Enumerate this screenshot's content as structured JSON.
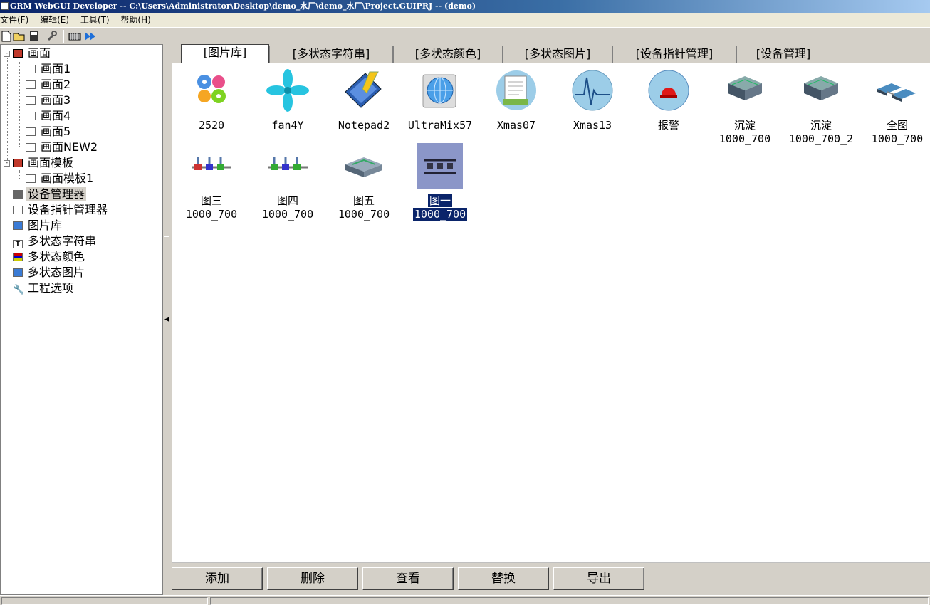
{
  "window": {
    "title": "GRM WebGUI Developer -- C:\\Users\\Administrator\\Desktop\\demo_水厂\\demo_水厂\\Project.GUIPRJ -- (demo)"
  },
  "menu": [
    {
      "label": "文件(F)"
    },
    {
      "label": "编辑(E)"
    },
    {
      "label": "工具(T)"
    },
    {
      "label": "帮助(H)"
    }
  ],
  "toolbar_icons": [
    "new-icon",
    "open-icon",
    "save-icon",
    "wrench-icon",
    "device-icon",
    "run-icon"
  ],
  "tree": {
    "pages_label": "画面",
    "pages": [
      "画面1",
      "画面2",
      "画面3",
      "画面4",
      "画面5",
      "画面NEW2"
    ],
    "templates_label": "画面模板",
    "templates": [
      "画面模板1"
    ],
    "others": [
      "设备管理器",
      "设备指针管理器",
      "图片库",
      "多状态字符串",
      "多状态颜色",
      "多状态图片",
      "工程选项"
    ]
  },
  "tabs": [
    "[图片库]",
    "[多状态字符串]",
    "[多状态颜色]",
    "[多状态图片]",
    "[设备指针管理]",
    "[设备管理]"
  ],
  "gallery": [
    {
      "line1": "2520",
      "line2": "",
      "icon": "gears-icon"
    },
    {
      "line1": "fan4Y",
      "line2": "",
      "icon": "fan-icon"
    },
    {
      "line1": "Notepad2",
      "line2": "",
      "icon": "notepad-icon"
    },
    {
      "line1": "UltraMix57",
      "line2": "",
      "icon": "globe-icon"
    },
    {
      "line1": "Xmas07",
      "line2": "",
      "icon": "documents-icon"
    },
    {
      "line1": "Xmas13",
      "line2": "",
      "icon": "pulse-icon"
    },
    {
      "line1": "报警",
      "line2": "",
      "icon": "alarm-icon"
    },
    {
      "line1": "沉淀",
      "line2": "1000_700",
      "icon": "tank-icon"
    },
    {
      "line1": "沉淀",
      "line2": "1000_700_2",
      "icon": "tank-icon"
    },
    {
      "line1": "全图",
      "line2": "1000_700",
      "icon": "plant-icon"
    },
    {
      "line1": "图三",
      "line2": "1000_700",
      "icon": "pumps-icon"
    },
    {
      "line1": "图四",
      "line2": "1000_700",
      "icon": "pumps-icon"
    },
    {
      "line1": "图五",
      "line2": "1000_700",
      "icon": "basin-icon"
    },
    {
      "line1": "图一",
      "line2": "1000_700",
      "icon": "pipeline-icon",
      "selected": true
    }
  ],
  "buttons": {
    "add": "添加",
    "delete": "删除",
    "view": "查看",
    "replace": "替换",
    "export": "导出"
  },
  "colors": {
    "selection": "#0a246a",
    "face": "#d4d0c8",
    "title_gradient_start": "#0a246a"
  }
}
